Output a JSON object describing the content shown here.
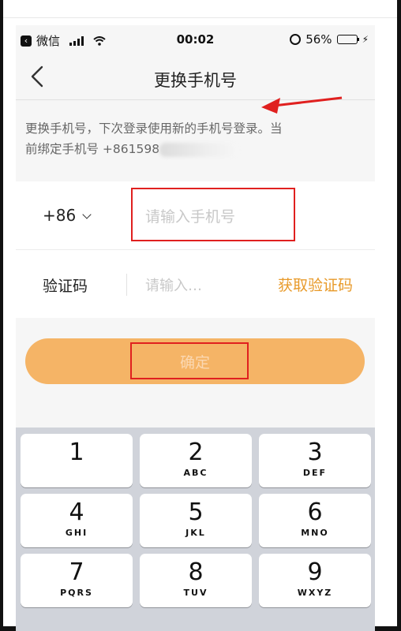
{
  "status_bar": {
    "back_app": "微信",
    "time": "00:02",
    "battery": "56%",
    "battery_level": 0.56
  },
  "nav": {
    "title": "更换手机号"
  },
  "notice": {
    "line1": "更换手机号，下次登录使用新的手机号登录。当",
    "line2": "前绑定手机号 +861598"
  },
  "phone_row": {
    "country_code": "+86",
    "placeholder": "请输入手机号"
  },
  "code_row": {
    "label": "验证码",
    "placeholder": "请输入…",
    "get_code": "获取验证码"
  },
  "confirm": {
    "label": "确定"
  },
  "keyboard": {
    "keys": [
      {
        "digit": "1",
        "letters": ""
      },
      {
        "digit": "2",
        "letters": "ABC"
      },
      {
        "digit": "3",
        "letters": "DEF"
      },
      {
        "digit": "4",
        "letters": "GHI"
      },
      {
        "digit": "5",
        "letters": "JKL"
      },
      {
        "digit": "6",
        "letters": "MNO"
      },
      {
        "digit": "7",
        "letters": "PQRS"
      },
      {
        "digit": "8",
        "letters": "TUV"
      },
      {
        "digit": "9",
        "letters": "WXYZ"
      }
    ]
  },
  "colors": {
    "accent": "#e89a2a",
    "confirm_bg": "#f5b466",
    "annotation": "#e0201f"
  }
}
